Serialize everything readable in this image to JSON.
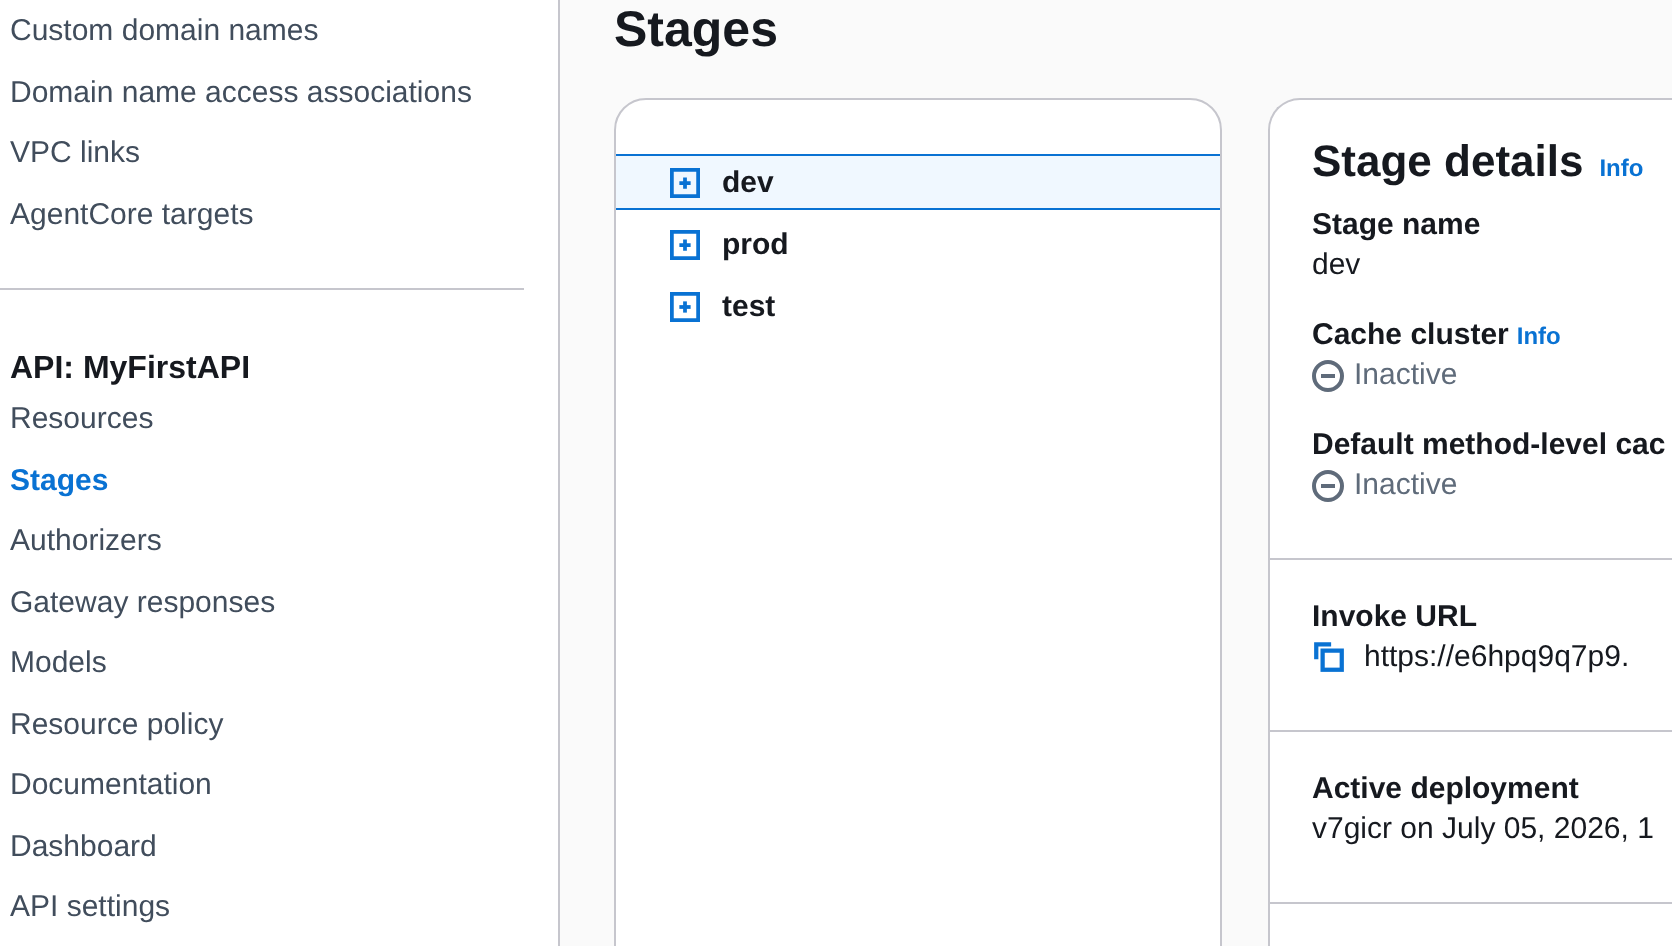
{
  "sidebar": {
    "items": [
      {
        "label": "Custom domain names",
        "selected": false
      },
      {
        "label": "Domain name access associations",
        "selected": false
      },
      {
        "label": "VPC links",
        "selected": false
      },
      {
        "label": "AgentCore targets",
        "selected": false
      }
    ],
    "section_title": "API: MyFirstAPI",
    "api_items": [
      {
        "label": "Resources",
        "selected": false
      },
      {
        "label": "Stages",
        "selected": true
      },
      {
        "label": "Authorizers",
        "selected": false
      },
      {
        "label": "Gateway responses",
        "selected": false
      },
      {
        "label": "Models",
        "selected": false
      },
      {
        "label": "Resource policy",
        "selected": false
      },
      {
        "label": "Documentation",
        "selected": false
      },
      {
        "label": "Dashboard",
        "selected": false
      },
      {
        "label": "API settings",
        "selected": false
      }
    ]
  },
  "page_title": "Stages",
  "stage_tree": [
    {
      "label": "dev",
      "selected": true,
      "expanded": false
    },
    {
      "label": "prod",
      "selected": false,
      "expanded": false
    },
    {
      "label": "test",
      "selected": false,
      "expanded": false
    }
  ],
  "stage_details": {
    "title": "Stage details",
    "info": "Info",
    "sections": [
      {
        "fields": [
          {
            "label": "Stage name",
            "kind": "text",
            "value": "dev"
          },
          {
            "label": "Cache cluster",
            "info": "Info",
            "kind": "status",
            "value": "Inactive"
          },
          {
            "label": "Default method-level cac",
            "kind": "status",
            "value": "Inactive"
          }
        ]
      },
      {
        "fields": [
          {
            "label": "Invoke URL",
            "kind": "url",
            "value": "https://e6hpq9q7p9."
          }
        ]
      },
      {
        "fields": [
          {
            "label": "Active deployment",
            "kind": "text",
            "value": "v7gicr on July 05, 2026, 1"
          }
        ]
      }
    ]
  }
}
